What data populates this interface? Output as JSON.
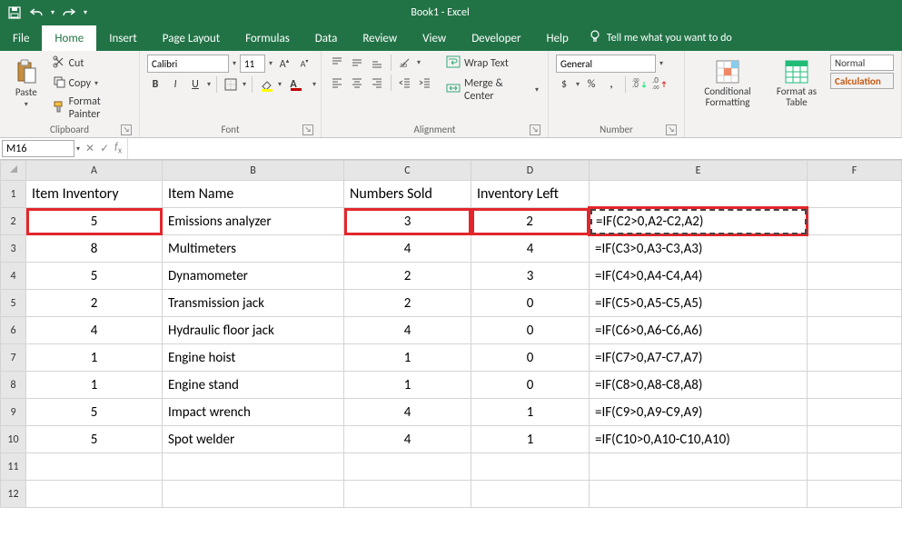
{
  "app": {
    "title": "Book1 - Excel"
  },
  "qat": {
    "save": "save-icon",
    "undo": "undo-icon",
    "redo": "redo-icon"
  },
  "tabs": [
    "File",
    "Home",
    "Insert",
    "Page Layout",
    "Formulas",
    "Data",
    "Review",
    "View",
    "Developer",
    "Help"
  ],
  "active_tab": "Home",
  "tell_me": "Tell me what you want to do",
  "ribbon": {
    "clipboard": {
      "label": "Clipboard",
      "paste": "Paste",
      "cut": "Cut",
      "copy": "Copy",
      "format_painter": "Format Painter"
    },
    "font": {
      "label": "Font",
      "name": "Calibri",
      "size": "11",
      "bold": "B",
      "italic": "I",
      "underline": "U"
    },
    "alignment": {
      "label": "Alignment",
      "wrap": "Wrap Text",
      "merge": "Merge & Center"
    },
    "number": {
      "label": "Number",
      "format": "General",
      "currency": "$",
      "percent": "%",
      "comma": ","
    },
    "styles": {
      "label": "",
      "cond": "Conditional Formatting",
      "table": "Format as Table",
      "normal": "Normal",
      "calc": "Calculation"
    }
  },
  "namebox": "M16",
  "formula": "",
  "columns": [
    "A",
    "B",
    "C",
    "D",
    "E",
    "F"
  ],
  "headers": {
    "A": "Item Inventory",
    "B": "Item Name",
    "C": "Numbers Sold",
    "D": "Inventory Left",
    "E": "",
    "F": ""
  },
  "rows": [
    {
      "A": "5",
      "B": "Emissions analyzer",
      "C": "3",
      "D": "2",
      "E": "=IF(C2>0,A2-C2,A2)",
      "hl": true
    },
    {
      "A": "8",
      "B": "Multimeters",
      "C": "4",
      "D": "4",
      "E": "=IF(C3>0,A3-C3,A3)"
    },
    {
      "A": "5",
      "B": "Dynamometer",
      "C": "2",
      "D": "3",
      "E": "=IF(C4>0,A4-C4,A4)"
    },
    {
      "A": "2",
      "B": "Transmission jack",
      "C": "2",
      "D": "0",
      "E": "=IF(C5>0,A5-C5,A5)"
    },
    {
      "A": "4",
      "B": "Hydraulic floor jack",
      "C": "4",
      "D": "0",
      "E": "=IF(C6>0,A6-C6,A6)"
    },
    {
      "A": "1",
      "B": "Engine hoist",
      "C": "1",
      "D": "0",
      "E": "=IF(C7>0,A7-C7,A7)"
    },
    {
      "A": "1",
      "B": "Engine stand",
      "C": "1",
      "D": "0",
      "E": "=IF(C8>0,A8-C8,A8)"
    },
    {
      "A": "5",
      "B": "Impact wrench",
      "C": "4",
      "D": "1",
      "E": "=IF(C9>0,A9-C9,A9)"
    },
    {
      "A": "5",
      "B": "Spot welder",
      "C": "4",
      "D": "1",
      "E": "=IF(C10>0,A10-C10,A10)"
    }
  ]
}
